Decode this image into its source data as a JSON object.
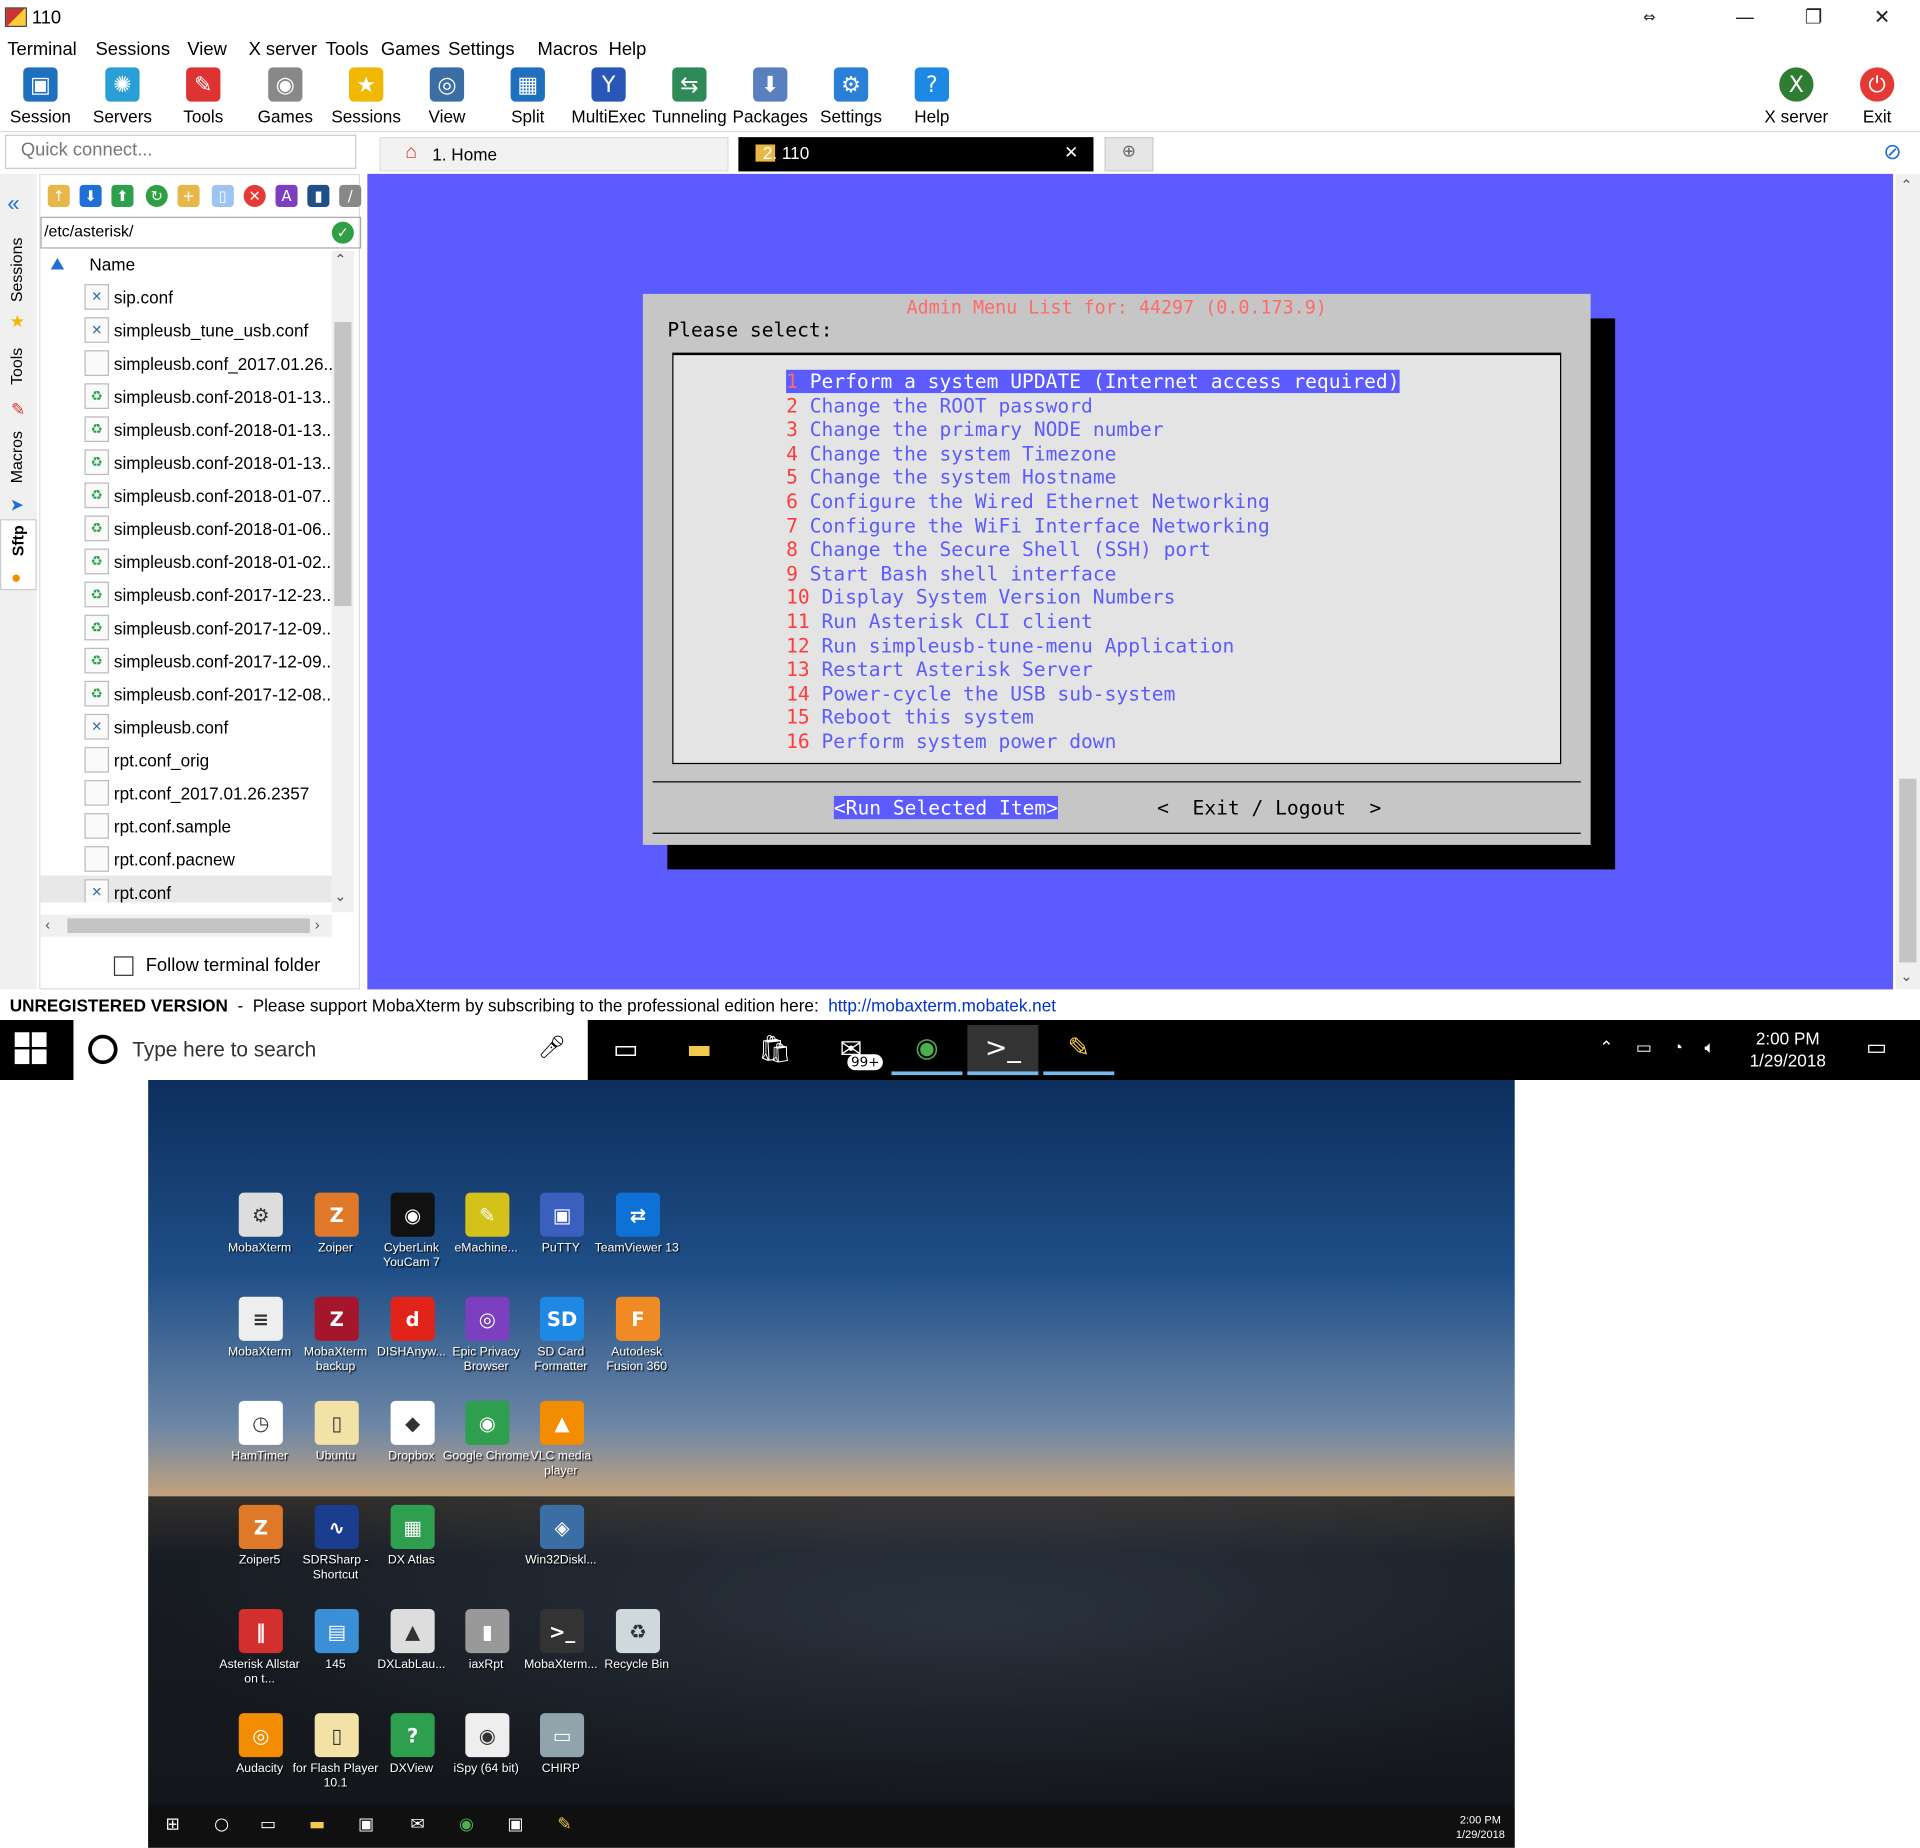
{
  "window": {
    "title": "110"
  },
  "menu": [
    "Terminal",
    "Sessions",
    "View",
    "X server",
    "Tools",
    "Games",
    "Settings",
    "Macros",
    "Help"
  ],
  "toolbar": [
    {
      "label": "Session",
      "icon": "session-icon",
      "color": "#1f6fbf",
      "glyph": "▣"
    },
    {
      "label": "Servers",
      "icon": "servers-icon",
      "color": "#2a9fd6",
      "glyph": "✺"
    },
    {
      "label": "Tools",
      "icon": "tools-icon",
      "color": "#d33",
      "glyph": "✎"
    },
    {
      "label": "Games",
      "icon": "games-icon",
      "color": "#888",
      "glyph": "◉"
    },
    {
      "label": "Sessions",
      "icon": "star-icon",
      "color": "#f2b700",
      "glyph": "★"
    },
    {
      "label": "View",
      "icon": "view-icon",
      "color": "#3a6ea5",
      "glyph": "◎"
    },
    {
      "label": "Split",
      "icon": "split-icon",
      "color": "#1f6fbf",
      "glyph": "▦"
    },
    {
      "label": "MultiExec",
      "icon": "multiexec-icon",
      "color": "#2857b7",
      "glyph": "Y"
    },
    {
      "label": "Tunneling",
      "icon": "tunneling-icon",
      "color": "#2e8b57",
      "glyph": "⇆"
    },
    {
      "label": "Packages",
      "icon": "packages-icon",
      "color": "#5a7fbf",
      "glyph": "⬇"
    },
    {
      "label": "Settings",
      "icon": "settings-icon",
      "color": "#2a7fd6",
      "glyph": "⚙"
    },
    {
      "label": "Help",
      "icon": "help-icon",
      "color": "#1e88e5",
      "glyph": "?"
    }
  ],
  "toolbar_right": [
    {
      "label": "X server",
      "icon": "xserver-icon",
      "color": "#2e7d32",
      "glyph": "X"
    },
    {
      "label": "Exit",
      "icon": "power-icon",
      "color": "#e53935",
      "glyph": "⏻"
    }
  ],
  "quick_connect": {
    "placeholder": "Quick connect..."
  },
  "tabs": [
    {
      "label": "1. Home"
    },
    {
      "label": "2. 110"
    }
  ],
  "side_tabs": [
    "Sessions",
    "Tools",
    "Macros",
    "Sftp"
  ],
  "sftp": {
    "path": "/etc/asterisk/",
    "column_name": "Name",
    "files": [
      {
        "name": "sip.conf",
        "type": "conf"
      },
      {
        "name": "simpleusb_tune_usb.conf",
        "type": "conf"
      },
      {
        "name": "simpleusb.conf_2017.01.26....",
        "type": "blank"
      },
      {
        "name": "simpleusb.conf-2018-01-13....",
        "type": "backup"
      },
      {
        "name": "simpleusb.conf-2018-01-13....",
        "type": "backup"
      },
      {
        "name": "simpleusb.conf-2018-01-13....",
        "type": "backup"
      },
      {
        "name": "simpleusb.conf-2018-01-07....",
        "type": "backup"
      },
      {
        "name": "simpleusb.conf-2018-01-06....",
        "type": "backup"
      },
      {
        "name": "simpleusb.conf-2018-01-02....",
        "type": "backup"
      },
      {
        "name": "simpleusb.conf-2017-12-23....",
        "type": "backup"
      },
      {
        "name": "simpleusb.conf-2017-12-09....",
        "type": "backup"
      },
      {
        "name": "simpleusb.conf-2017-12-09....",
        "type": "backup"
      },
      {
        "name": "simpleusb.conf-2017-12-08....",
        "type": "backup"
      },
      {
        "name": "simpleusb.conf",
        "type": "conf"
      },
      {
        "name": "rpt.conf_orig",
        "type": "blank"
      },
      {
        "name": "rpt.conf_2017.01.26.2357",
        "type": "blank"
      },
      {
        "name": "rpt.conf.sample",
        "type": "blank"
      },
      {
        "name": "rpt.conf.pacnew",
        "type": "blank"
      },
      {
        "name": "rpt.conf",
        "type": "conf"
      }
    ],
    "follow_label": "Follow terminal folder"
  },
  "terminal": {
    "dialog_title": "Admin Menu List for: 44297 (0.0.173.9)",
    "prompt": "Please select:",
    "items": [
      {
        "num": "1",
        "text": " Perform a system UPDATE (Internet access required)",
        "selected": true
      },
      {
        "num": "2",
        "text": " Change the ROOT password"
      },
      {
        "num": "3",
        "text": " Change the primary NODE number"
      },
      {
        "num": "4",
        "text": " Change the system Timezone"
      },
      {
        "num": "5",
        "text": " Change the system Hostname"
      },
      {
        "num": "6",
        "text": " Configure the Wired Ethernet Networking"
      },
      {
        "num": "7",
        "text": " Configure the WiFi Interface Networking"
      },
      {
        "num": "8",
        "text": " Change the Secure Shell (SSH) port"
      },
      {
        "num": "9",
        "text": " Start Bash shell interface"
      },
      {
        "num": "10",
        "text": " Display System Version Numbers"
      },
      {
        "num": "11",
        "text": " Run Asterisk CLI client"
      },
      {
        "num": "12",
        "text": " Run simpleusb-tune-menu Application"
      },
      {
        "num": "13",
        "text": " Restart Asterisk Server"
      },
      {
        "num": "14",
        "text": " Power-cycle the USB sub-system"
      },
      {
        "num": "15",
        "text": " Reboot this system"
      },
      {
        "num": "16",
        "text": " Perform system power down"
      }
    ],
    "run_button": "<Run Selected Item>",
    "exit_button": "<  Exit / Logout  >",
    "colors": {
      "background": "#5b5bff",
      "dialog": "#c6c6c6",
      "number": "#ff3b3b"
    }
  },
  "status": {
    "bold": "UNREGISTERED VERSION",
    "text": "  -  Please support MobaXterm by subscribing to the professional edition here:  ",
    "link": "http://mobaxterm.mobatek.net"
  },
  "taskbar": {
    "search_placeholder": "Type here to search",
    "mail_badge": "99+",
    "time": "2:00 PM",
    "date": "1/29/2018"
  },
  "desktop": {
    "icons": [
      {
        "label": "MobaXterm",
        "color": "#ddd",
        "glyph": "⚙"
      },
      {
        "label": "Zoiper",
        "color": "#e0782a",
        "glyph": "Z"
      },
      {
        "label": "CyberLink YouCam 7",
        "color": "#111",
        "glyph": "◉"
      },
      {
        "label": "eMachine...",
        "color": "#d4c21a",
        "glyph": "✎"
      },
      {
        "label": "PuTTY",
        "color": "#3a5fbf",
        "glyph": "▣"
      },
      {
        "label": "TeamViewer 13",
        "color": "#0e71d6",
        "glyph": "⇄"
      },
      {
        "label": "MobaXterm",
        "color": "#eee",
        "glyph": "≡"
      },
      {
        "label": "MobaXterm backup",
        "color": "#a5162c",
        "glyph": "Z"
      },
      {
        "label": "DISHAnyw...",
        "color": "#e2231a",
        "glyph": "d"
      },
      {
        "label": "Epic Privacy Browser",
        "color": "#7b3fbf",
        "glyph": "◎"
      },
      {
        "label": "SD Card Formatter",
        "color": "#1e88e5",
        "glyph": "SD"
      },
      {
        "label": "Autodesk Fusion 360",
        "color": "#f08a24",
        "glyph": "F"
      },
      {
        "label": "HamTimer",
        "color": "#fff",
        "glyph": "◷"
      },
      {
        "label": "Ubuntu",
        "color": "#f3e2a5",
        "glyph": "▯"
      },
      {
        "label": "Dropbox",
        "color": "#fff",
        "glyph": "◆"
      },
      {
        "label": "Google Chrome",
        "color": "#2e9e4f",
        "glyph": "◉"
      },
      {
        "label": "VLC media player",
        "color": "#f28c00",
        "glyph": "▲"
      },
      {
        "label": "Zoiper5",
        "color": "#e0782a",
        "glyph": "Z"
      },
      {
        "label": "SDRSharp - Shortcut",
        "color": "#1b3d8f",
        "glyph": "∿"
      },
      {
        "label": "DX Atlas",
        "color": "#2e9e4f",
        "glyph": "▦"
      },
      {
        "label": "Win32Diskl...",
        "color": "#3a6ea5",
        "glyph": "◈"
      },
      {
        "label": "Asterisk Allstar on t...",
        "color": "#d32f2f",
        "glyph": "‖"
      },
      {
        "label": "145",
        "color": "#3a8fd6",
        "glyph": "▤"
      },
      {
        "label": "DXLabLau...",
        "color": "#ddd",
        "glyph": "▲"
      },
      {
        "label": "iaxRpt",
        "color": "#999",
        "glyph": "▮"
      },
      {
        "label": "MobaXterm...",
        "color": "#333",
        "glyph": ">_"
      },
      {
        "label": "Recycle Bin",
        "color": "#cfd8dc",
        "glyph": "♻"
      },
      {
        "label": "Audacity",
        "color": "#f28c00",
        "glyph": "◎"
      },
      {
        "label": "for Flash Player 10.1",
        "color": "#f3e2a5",
        "glyph": "▯"
      },
      {
        "label": "DXView",
        "color": "#2e9e4f",
        "glyph": "?"
      },
      {
        "label": "iSpy (64 bit)",
        "color": "#eee",
        "glyph": "◉"
      },
      {
        "label": "CHIRP",
        "color": "#90a4ae",
        "glyph": "▭"
      }
    ],
    "time": "2:00 PM",
    "date": "1/29/2018"
  }
}
